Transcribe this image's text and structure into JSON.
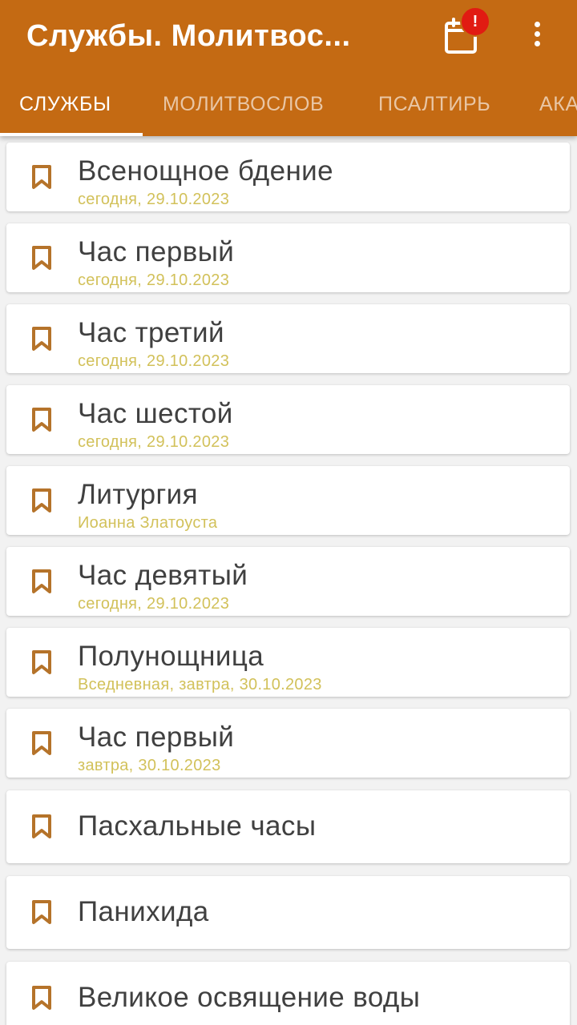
{
  "header": {
    "title": "Службы. Молитвос...",
    "badge": "!"
  },
  "tabs": [
    {
      "label": "СЛУЖБЫ",
      "active": true
    },
    {
      "label": "МОЛИТВОСЛОВ",
      "active": false
    },
    {
      "label": "ПСАЛТИРЬ",
      "active": false
    },
    {
      "label": "АКА",
      "active": false
    }
  ],
  "services": [
    {
      "title": "Всенощное бдение",
      "subtitle": "сегодня, 29.10.2023"
    },
    {
      "title": "Час первый",
      "subtitle": "сегодня, 29.10.2023"
    },
    {
      "title": "Час третий",
      "subtitle": "сегодня, 29.10.2023"
    },
    {
      "title": "Час шестой",
      "subtitle": "сегодня, 29.10.2023"
    },
    {
      "title": "Литургия",
      "subtitle": "Иоанна Златоуста"
    },
    {
      "title": "Час девятый",
      "subtitle": "сегодня, 29.10.2023"
    },
    {
      "title": "Полунощница",
      "subtitle": "Вседневная, завтра, 30.10.2023"
    },
    {
      "title": "Час первый",
      "subtitle": "завтра, 30.10.2023"
    },
    {
      "title": "Пасхальные часы"
    },
    {
      "title": "Панихида"
    },
    {
      "title": "Великое освящение воды"
    }
  ],
  "colors": {
    "app_bar": "#c46a13",
    "bookmark_icon": "#b5732a",
    "subtitle": "#d2c15a",
    "badge": "#e11b12"
  },
  "icons": {
    "calendar": "calendar-icon",
    "more": "more-vert-icon",
    "bookmark": "bookmark-icon"
  }
}
